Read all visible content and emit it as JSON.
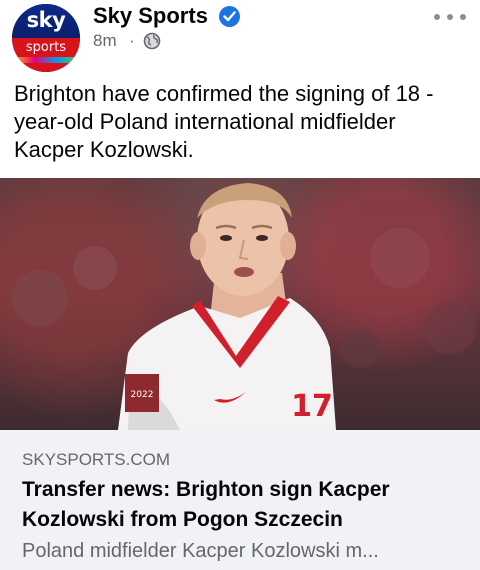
{
  "post": {
    "page_name": "Sky Sports",
    "avatar_logo_top": "sky",
    "avatar_logo_bottom": "sports",
    "timestamp": "8m",
    "separator": "·",
    "audience_icon": "globe-icon",
    "text": "Brighton have confirmed the signing of 18 -year-old Poland international midfielder Kacper Kozlowski.",
    "colors": {
      "verified": "#1b74e4",
      "secondary_text": "#65676b",
      "link_bg": "#f0f2f5",
      "sky_blue": "#0b2a8a",
      "sky_red": "#d9131b"
    }
  },
  "link_preview": {
    "domain": "SKYSPORTS.COM",
    "title": "Transfer news: Brighton sign Kacper Kozlowski from Pogon Szczecin",
    "description": "Poland midfielder Kacper Kozlowski m..."
  },
  "photo": {
    "jersey_number": "17",
    "badge": "2022"
  }
}
